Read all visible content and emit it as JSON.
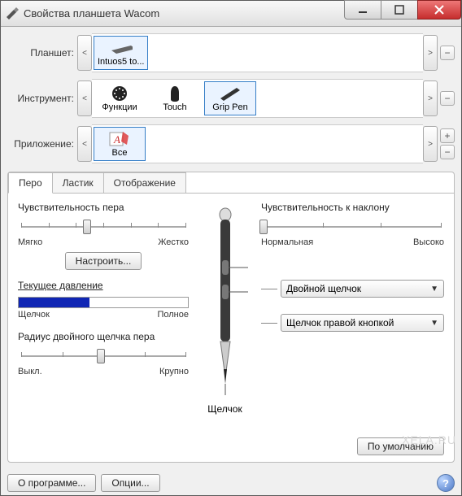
{
  "window": {
    "title": "Свойства планшета Wacom"
  },
  "selectors": {
    "tablet_label": "Планшет:",
    "tool_label": "Инструмент:",
    "app_label": "Приложение:",
    "tablet_items": [
      {
        "label": "Intuos5 to...",
        "selected": true
      }
    ],
    "tool_items": [
      {
        "label": "Функции",
        "selected": false
      },
      {
        "label": "Touch",
        "selected": false
      },
      {
        "label": "Grip Pen",
        "selected": true
      }
    ],
    "app_items": [
      {
        "label": "Все",
        "selected": true
      }
    ]
  },
  "tabs": {
    "pen": "Перо",
    "eraser": "Ластик",
    "mapping": "Отображение"
  },
  "pen_panel": {
    "tip_feel_title": "Чувствительность пера",
    "tip_feel_left": "Мягко",
    "tip_feel_right": "Жестко",
    "customize": "Настроить...",
    "current_pressure": "Текущее давление",
    "pressure_left": "Щелчок",
    "pressure_right": "Полное",
    "dblclick_title": "Радиус двойного щелчка пера",
    "dblclick_left": "Выкл.",
    "dblclick_right": "Крупно",
    "tilt_title": "Чувствительность к наклону",
    "tilt_left": "Нормальная",
    "tilt_right": "Высоко",
    "upper_button": "Двойной щелчок",
    "lower_button": "Щелчок правой кнопкой",
    "tip_action": "Щелчок",
    "default_btn": "По умолчанию"
  },
  "footer": {
    "about": "О программе...",
    "options": "Опции..."
  },
  "watermark": "XELA.RU"
}
